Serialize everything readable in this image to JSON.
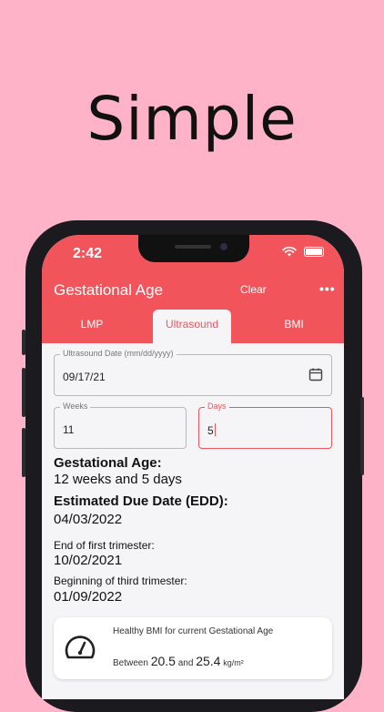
{
  "headline": "Simple",
  "status": {
    "time": "2:42"
  },
  "app": {
    "title": "Gestational Age",
    "clear_label": "Clear",
    "more_label": "•••"
  },
  "tabs": [
    {
      "label": "LMP"
    },
    {
      "label": "Ultrasound"
    },
    {
      "label": "BMI"
    }
  ],
  "selected_tab": "Ultrasound",
  "form": {
    "date_label": "Ultrasound Date (mm/dd/yyyy)",
    "date_value": "09/17/21",
    "weeks_label": "Weeks",
    "weeks_value": "11",
    "days_label": "Days",
    "days_value": "5"
  },
  "results": {
    "ga_label": "Gestational Age:",
    "ga_value": "12 weeks and 5 days",
    "edd_label": "Estimated Due Date (EDD):",
    "edd_value": "04/03/2022",
    "first_tri_label": "End of first trimester:",
    "first_tri_value": "10/02/2021",
    "third_tri_label": "Beginning of third trimester:",
    "third_tri_value": "01/09/2022"
  },
  "bmi_card": {
    "title": "Healthy BMI for current Gestational Age",
    "between": "Between",
    "low": "20.5",
    "and": "and",
    "high": "25.4",
    "unit": "kg/m²"
  },
  "colors": {
    "accent": "#f2545b",
    "background": "#ffb3c8",
    "screen": "#f5f5f7"
  },
  "icons": [
    "wifi-icon",
    "battery-icon",
    "moon-icon",
    "more-icon",
    "calendar-icon",
    "gauge-icon"
  ]
}
